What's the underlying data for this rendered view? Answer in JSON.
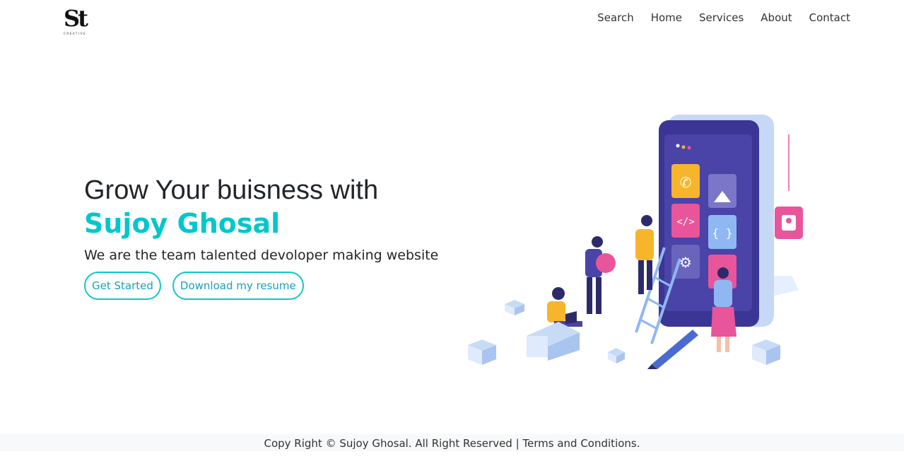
{
  "brand": {
    "logo_mark": "St",
    "logo_sub": "CREATIVE"
  },
  "nav": {
    "items": [
      {
        "label": "Search"
      },
      {
        "label": "Home"
      },
      {
        "label": "Services"
      },
      {
        "label": "About"
      },
      {
        "label": "Contact"
      }
    ]
  },
  "hero": {
    "headline": "Grow Your buisness with",
    "name": "Sujoy Ghosal",
    "tagline": "We are the team talented devoloper making website",
    "buttons": {
      "primary": "Get Started",
      "secondary": "Download my resume"
    }
  },
  "footer": {
    "text": "Copy Right © Sujoy Ghosal. All Right Reserved | Terms and Conditions."
  },
  "colors": {
    "accent": "#00c7cc",
    "phone": "#3b3596",
    "pink": "#e8559a",
    "yellow": "#f7b52c",
    "light_blue": "#c8dbf5"
  }
}
